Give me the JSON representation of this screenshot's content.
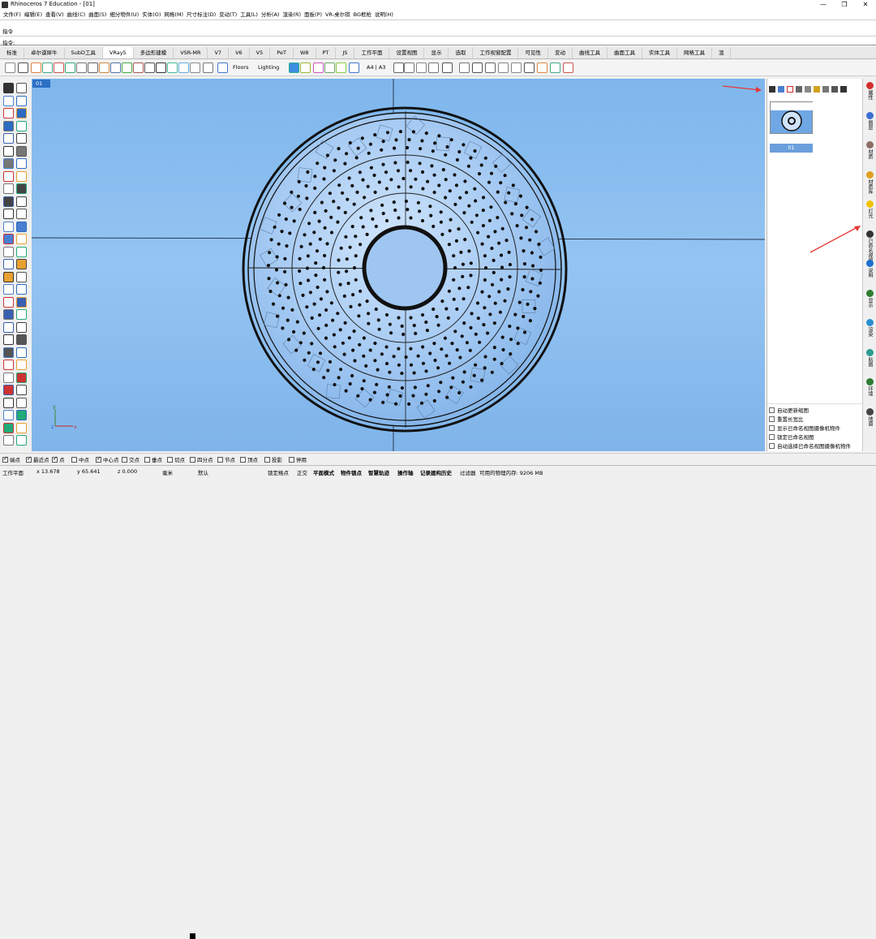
{
  "window": {
    "title": "Rhinoceros 7 Education - [01]"
  },
  "menu": [
    "文件(F)",
    "编辑(E)",
    "查看(V)",
    "曲线(C)",
    "曲面(S)",
    "细分物件(U)",
    "实体(O)",
    "网格(M)",
    "尺寸标注(D)",
    "变动(T)",
    "工具(L)",
    "分析(A)",
    "渲染(R)",
    "面板(P)",
    "VR-桌尔祺",
    "BG框枪",
    "说明(H)"
  ],
  "command": {
    "history_label": "指令",
    "prompt_label": "指令:",
    "value": ""
  },
  "tabs": [
    "标准",
    "卓尔谟犀牛",
    "SubD工具",
    "VRay5",
    "多边形建模",
    "VSR-MR",
    "V7",
    "V6",
    "V5",
    "PeT",
    "W8",
    "PT",
    "JS",
    "工作平面",
    "设置视图",
    "显示",
    "选取",
    "工作视窗配置",
    "可见性",
    "变动",
    "曲线工具",
    "曲面工具",
    "实体工具",
    "网格工具",
    "渲"
  ],
  "active_tab": "VRay5",
  "toolbar": {
    "floors_label": "Floors",
    "lighting_label": "Lighting",
    "paper_label": "A4 | A3"
  },
  "viewport": {
    "name": "01"
  },
  "named_views": {
    "thumb_label": "01"
  },
  "right_tabs": [
    "属性",
    "图层",
    "材质",
    "材质库",
    "灯光",
    "已命名视图",
    "说明",
    "显示",
    "渲染",
    "贴图",
    "环境",
    "地面"
  ],
  "view_options": [
    "自动更新缩图",
    "重置长宽比",
    "显示已命名视图摄像机物件",
    "锁定已命名视图",
    "自动选择已命名视图摄像机物件"
  ],
  "osnaps": [
    {
      "label": "端点",
      "on": true
    },
    {
      "label": "最近点",
      "on": true
    },
    {
      "label": "点",
      "on": true
    },
    {
      "label": "中点",
      "on": false
    },
    {
      "label": "中心点",
      "on": true
    },
    {
      "label": "交点",
      "on": false
    },
    {
      "label": "垂点",
      "on": false
    },
    {
      "label": "切点",
      "on": false
    },
    {
      "label": "四分点",
      "on": false
    },
    {
      "label": "节点",
      "on": false
    },
    {
      "label": "顶点",
      "on": false
    },
    {
      "label": "投影",
      "on": false
    },
    {
      "label": "停用",
      "on": false
    }
  ],
  "status": {
    "cplane": "工作平面",
    "x": "x 13.678",
    "y": "y 65.641",
    "z": "z 0.000",
    "unit": "毫米",
    "layer": "默认",
    "toggles": [
      "锁定格点",
      "正交",
      "平面模式",
      "物件锁点",
      "智慧轨迹",
      "操作轴",
      "记录建构历史",
      "过滤器"
    ],
    "memory": "可用的物理内存: 9206 MB"
  },
  "colors": {
    "viewport_bg": "#8bbcef",
    "accent": "#2b6fc4",
    "annotation_arrow": "#e53935"
  }
}
